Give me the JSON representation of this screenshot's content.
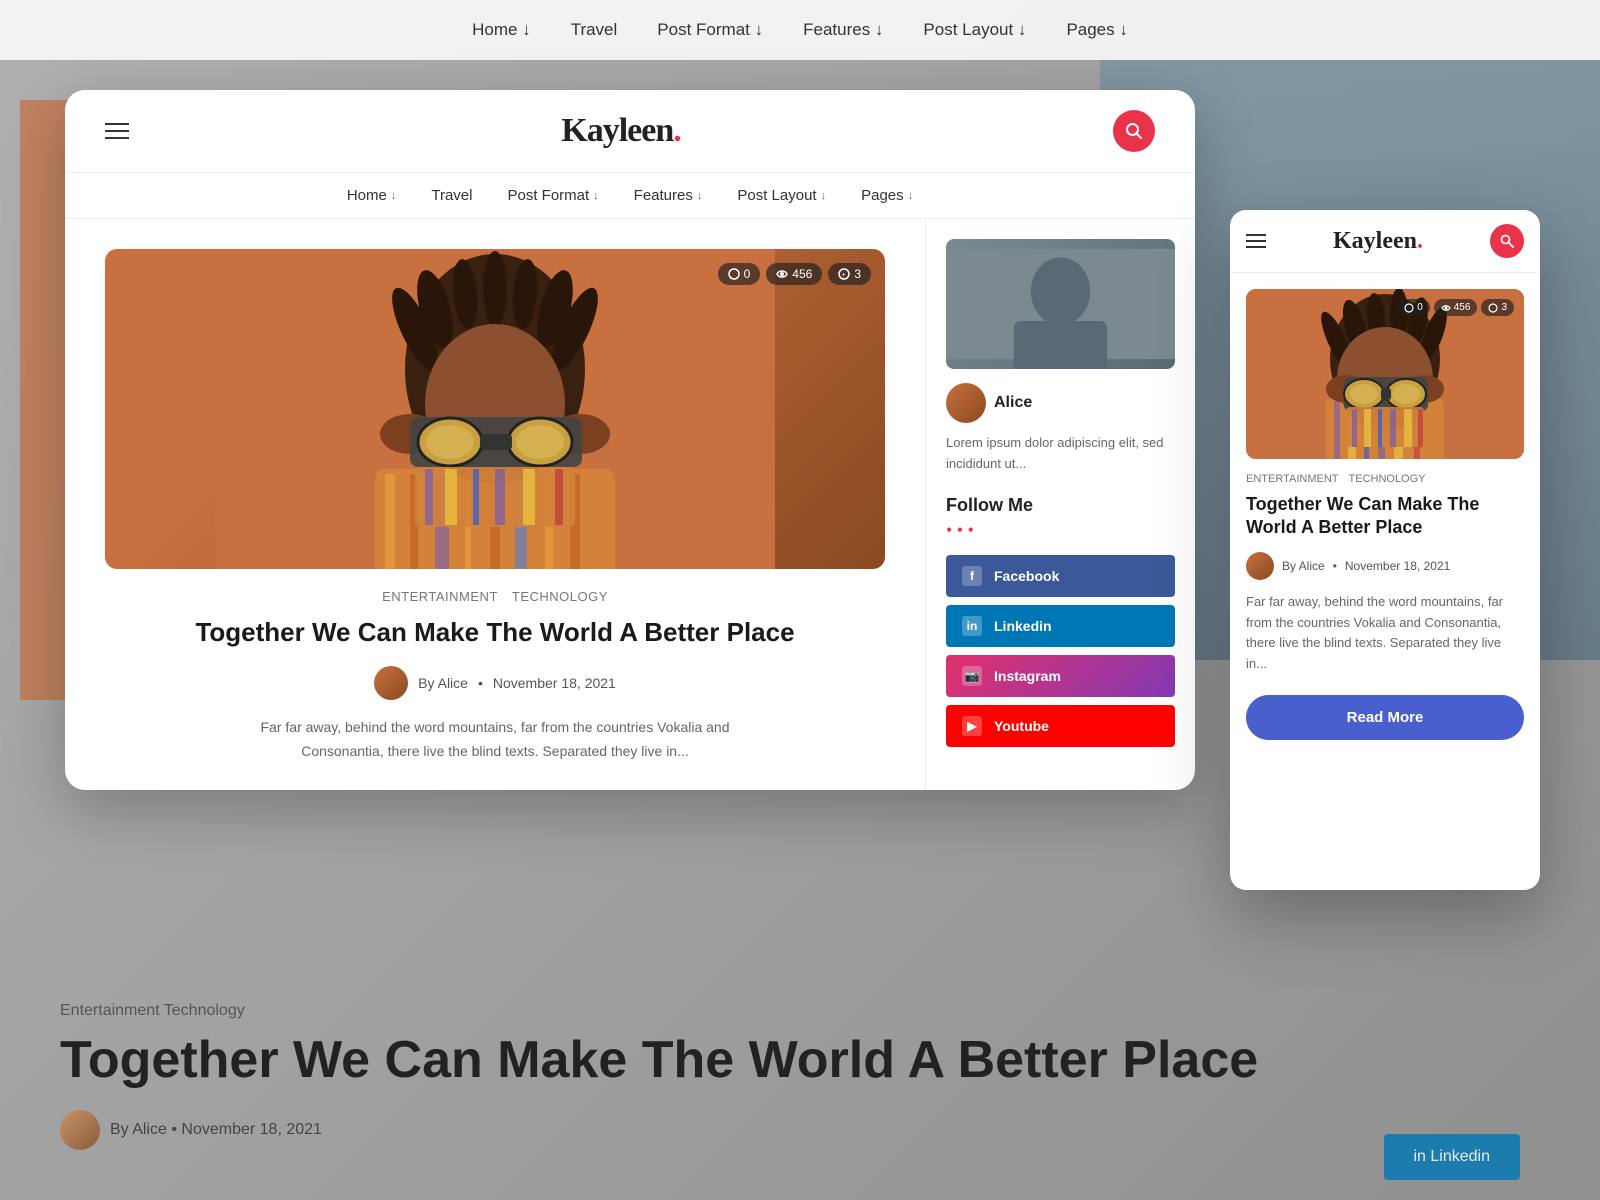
{
  "background": {
    "nav_items": [
      "Home ↓",
      "Travel",
      "Post Format ↓",
      "Features ↓",
      "Post Layout ↓",
      "Pages ↓"
    ],
    "bottom_cats": "Entertainment    Technology",
    "bottom_title": "Together We Can Make The World A Better Place",
    "bottom_author": "By Alice • November 18, 2021"
  },
  "desktop": {
    "logo": "Kayleen",
    "dot": ".",
    "nav": [
      {
        "label": "Home",
        "arrow": "↓"
      },
      {
        "label": "Travel",
        "arrow": ""
      },
      {
        "label": "Post Format",
        "arrow": "↓"
      },
      {
        "label": "Features",
        "arrow": "↓"
      },
      {
        "label": "Post Layout",
        "arrow": "↓"
      },
      {
        "label": "Pages",
        "arrow": "↓"
      }
    ],
    "article": {
      "categories": [
        "Entertainment",
        "Technology"
      ],
      "title": "Together We Can Make The World A Better Place",
      "author": "By Alice",
      "date": "November 18, 2021",
      "excerpt": "Far far away, behind the word mountains, far from the countries Vokalia and Consonantia, there live the blind texts. Separated they live in...",
      "badge_comments": "0",
      "badge_views": "456",
      "badge_likes": "3"
    },
    "sidebar": {
      "author_name": "Alice",
      "author_text": "Lorem ipsum dolor adipiscing elit, sed incididunt ut...",
      "follow_label": "Follow Me",
      "social": [
        {
          "name": "Facebook",
          "class": "facebook",
          "icon": "f"
        },
        {
          "name": "Linkedin",
          "class": "linkedin",
          "icon": "in"
        },
        {
          "name": "Instagram",
          "class": "instagram",
          "icon": "📷"
        },
        {
          "name": "Youtube",
          "class": "youtube",
          "icon": "▶"
        }
      ]
    }
  },
  "mobile": {
    "logo": "Kayleen",
    "dot": ".",
    "article": {
      "categories": [
        "Entertainment",
        "Technology"
      ],
      "title": "Together We Can Make The World A Better Place",
      "author": "By Alice",
      "date": "November 18, 2021",
      "excerpt": "Far far away, behind the word mountains, far from the countries Vokalia and Consonantia, there live the blind texts. Separated they live in...",
      "badge_comments": "0",
      "badge_views": "456",
      "badge_likes": "3",
      "read_more": "Read More"
    }
  }
}
